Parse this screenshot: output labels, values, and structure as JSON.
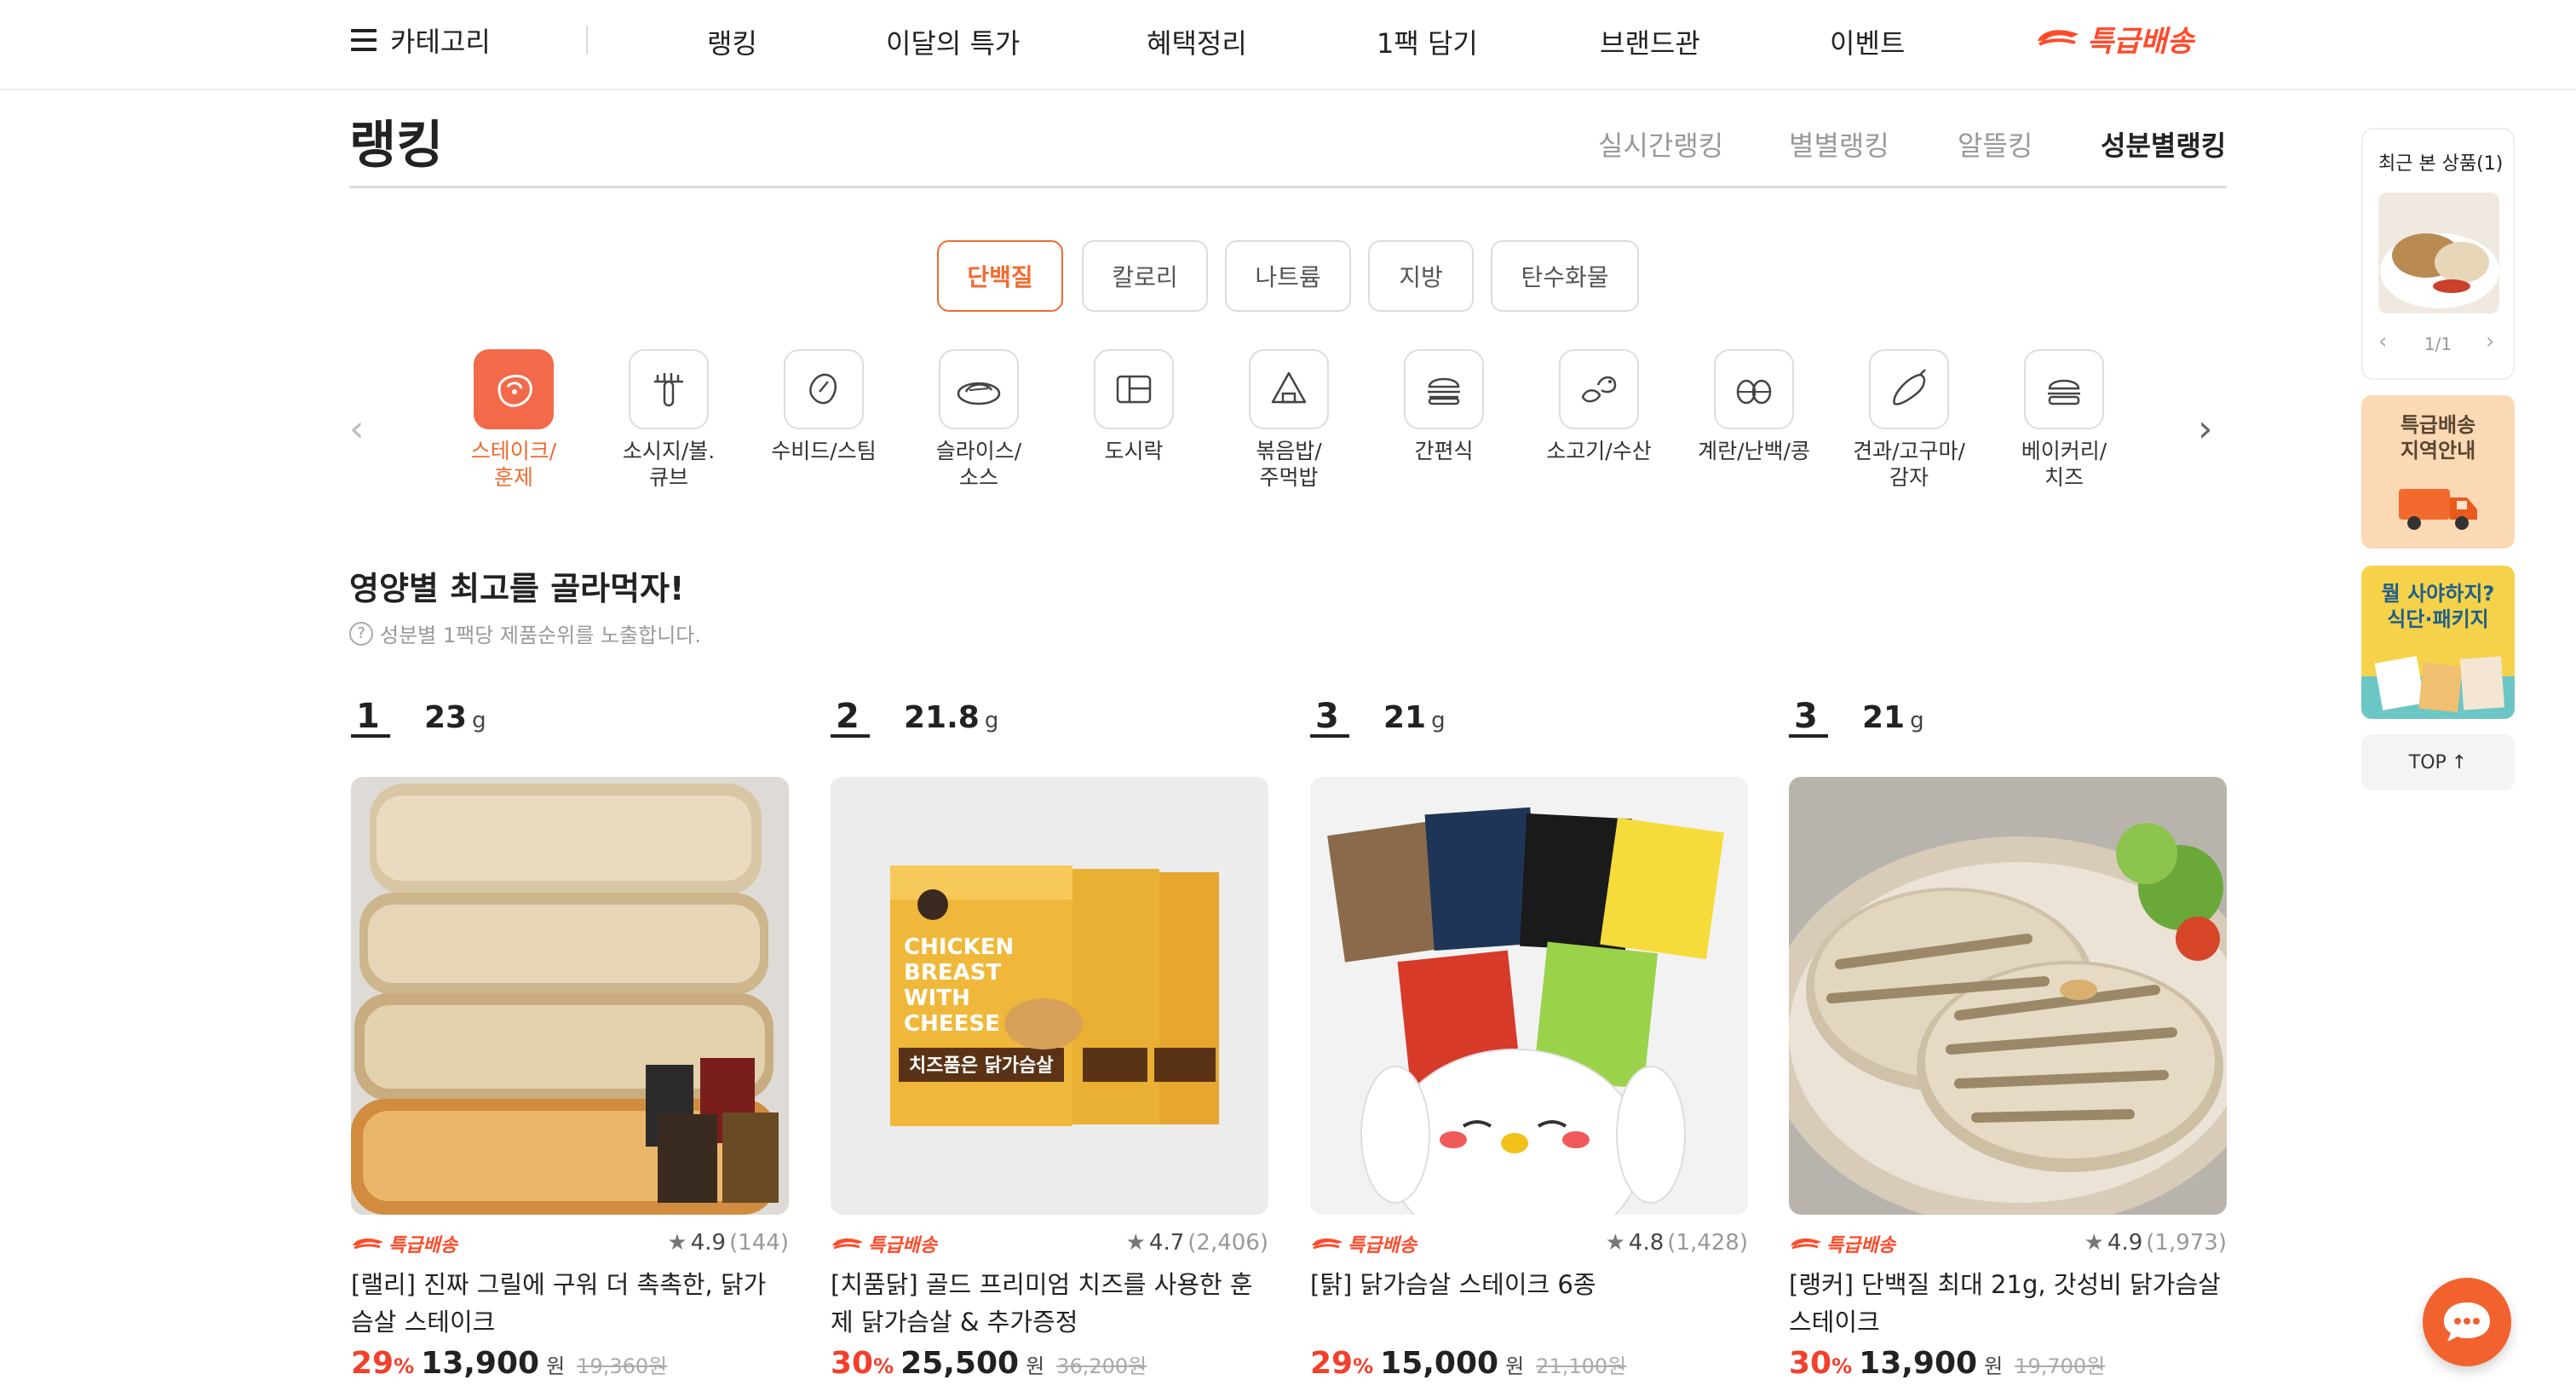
{
  "header": {
    "category_label": "카테고리",
    "menu_icon": "hamburger-icon",
    "nav": [
      "랭킹",
      "이달의 특가",
      "혜택정리",
      "1팩 담기",
      "브랜드관",
      "이벤트"
    ],
    "express_label": "특급배송"
  },
  "page": {
    "title": "랭킹",
    "rank_tabs": [
      "실시간랭킹",
      "별별랭킹",
      "알뜰킹",
      "성분별랭킹"
    ],
    "active_rank_tab": "성분별랭킹"
  },
  "nutrient_tabs": {
    "items": [
      "단백질",
      "칼로리",
      "나트륨",
      "지방",
      "탄수화물"
    ],
    "active": "단백질"
  },
  "categories": {
    "items": [
      {
        "label": "스테이크/\n훈제",
        "icon": "steak-icon"
      },
      {
        "label": "소시지/볼.\n큐브",
        "icon": "sausage-icon"
      },
      {
        "label": "수비드/스팀",
        "icon": "sous-vide-icon"
      },
      {
        "label": "슬라이스/\n소스",
        "icon": "sliced-plate-icon"
      },
      {
        "label": "도시락",
        "icon": "lunchbox-icon"
      },
      {
        "label": "볶음밥/\n주먹밥",
        "icon": "rice-ball-icon"
      },
      {
        "label": "간편식",
        "icon": "burger-icon"
      },
      {
        "label": "소고기/수산",
        "icon": "beef-fish-icon"
      },
      {
        "label": "계란/난백/콩",
        "icon": "egg-icon"
      },
      {
        "label": "견과/고구마/\n감자",
        "icon": "sweet-potato-icon"
      },
      {
        "label": "베이커리/\n치즈",
        "icon": "bakery-icon"
      }
    ],
    "active": "스테이크/\n훈제",
    "prev_icon": "chevron-left-icon",
    "next_icon": "chevron-right-icon"
  },
  "section": {
    "title": "영양별 최고를 골라먹자!",
    "note": "성분별 1팩당 제품순위를 노출합니다.",
    "note_icon": "question-circle-icon"
  },
  "products": [
    {
      "rank": "1",
      "amount": "23",
      "unit": "g",
      "badge": "특급배송",
      "rating": "4.9",
      "reviews": "(144)",
      "name": "[랠리] 진짜 그릴에 구워 더 촉촉한, 닭가슴살 스테이크",
      "discount": "29",
      "discount_unit": "%",
      "price": "13,900",
      "price_unit": "원",
      "original": "19,360원"
    },
    {
      "rank": "2",
      "amount": "21.8",
      "unit": "g",
      "badge": "특급배송",
      "rating": "4.7",
      "reviews": "(2,406)",
      "name": "[치품닭] 골드 프리미엄 치즈를 사용한 훈제 닭가슴살 & 추가증정",
      "discount": "30",
      "discount_unit": "%",
      "price": "25,500",
      "price_unit": "원",
      "original": "36,200원"
    },
    {
      "rank": "3",
      "amount": "21",
      "unit": "g",
      "badge": "특급배송",
      "rating": "4.8",
      "reviews": "(1,428)",
      "name": "[탉] 닭가슴살 스테이크 6종",
      "discount": "29",
      "discount_unit": "%",
      "price": "15,000",
      "price_unit": "원",
      "original": "21,100원"
    },
    {
      "rank": "3",
      "amount": "21",
      "unit": "g",
      "badge": "특급배송",
      "rating": "4.9",
      "reviews": "(1,973)",
      "name": "[랭커] 단백질 최대 21g, 갓성비 닭가슴살 스테이크",
      "discount": "30",
      "discount_unit": "%",
      "price": "13,900",
      "price_unit": "원",
      "original": "19,700원"
    }
  ],
  "product_image_text": {
    "pack_english": "CHICKEN BREAST WITH CHEESE",
    "pack_korean": "치즈품은 닭가슴살"
  },
  "sidebar": {
    "recent_title": "최근 본 상품(1)",
    "recent_pagination": "1/1",
    "banner1": "특급배송\n지역안내",
    "banner2": "뭘 사야하지?\n식단·패키지",
    "top_label": "TOP",
    "top_icon": "arrow-up-icon"
  },
  "chat": {
    "icon": "chat-bubble-icon"
  },
  "colors": {
    "accent": "#f26a2e",
    "discount": "#f2402c",
    "express": "#ff4b2b"
  }
}
